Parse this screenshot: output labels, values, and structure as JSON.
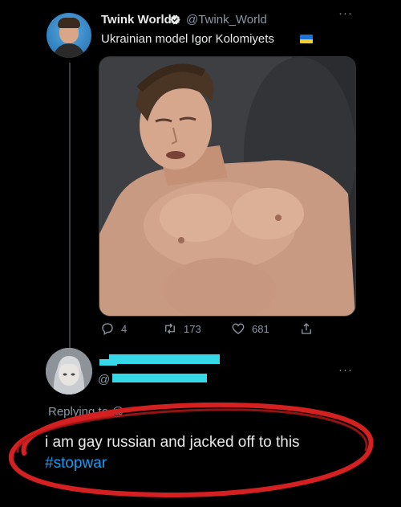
{
  "tweet": {
    "author_name": "Twink World",
    "author_handle": "@Twink_World",
    "text": "Ukrainian model Igor Kolomiyets",
    "more": "···",
    "stats": {
      "replies": "4",
      "retweets": "173",
      "likes": "681"
    }
  },
  "reply": {
    "handle_prefix": "@",
    "replying_to": "Replying to @",
    "more": "···",
    "text_before": "i am gay russian and jacked off to this ",
    "hashtag": "#stopwar"
  },
  "colors": {
    "background": "#000000",
    "accent": "#1d9bf0",
    "redaction": "#36d7e6",
    "marker": "#d42020"
  }
}
